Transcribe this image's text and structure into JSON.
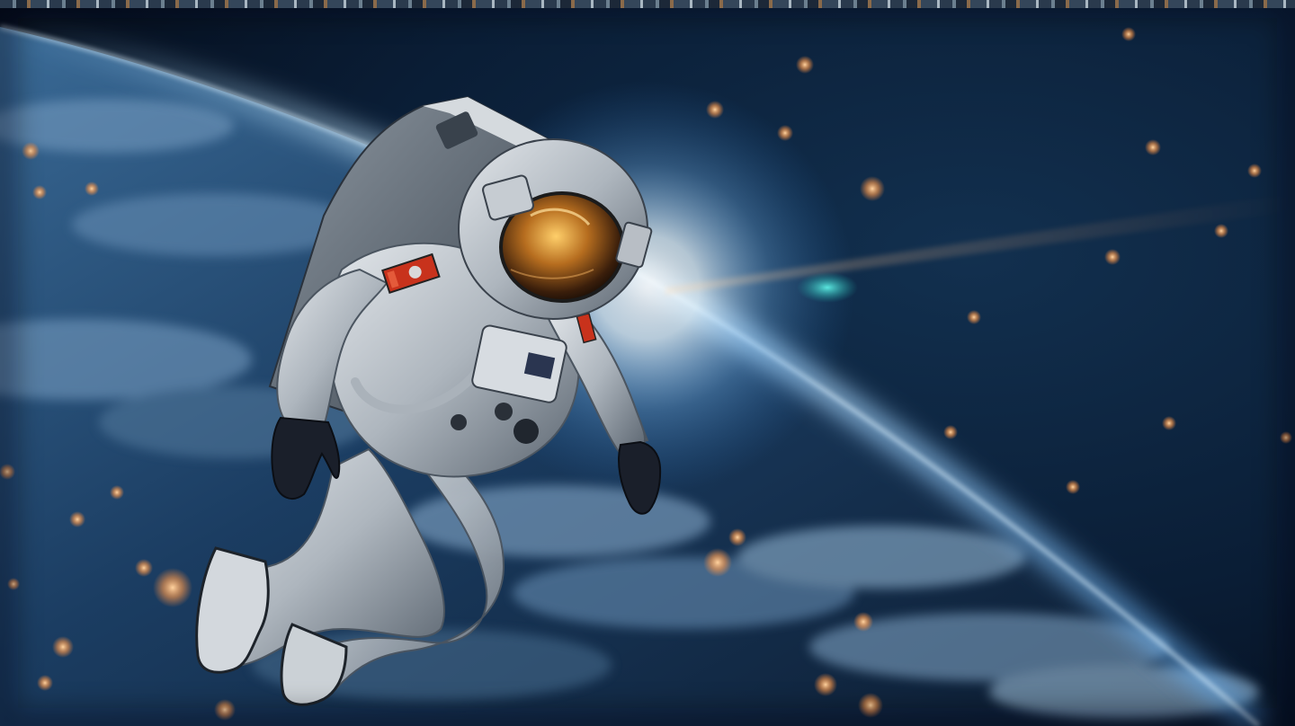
{
  "scene": {
    "subject": "astronaut-floating-above-planet",
    "palette": {
      "space_deep": "#06101f",
      "space_mid": "#0d2744",
      "atmosphere_glow": "#bfe6ff",
      "atmosphere_blue": "#2f7fd0",
      "planet_dark": "#0e2238",
      "cloud": "#5d7f9e",
      "suit": "#c9ced4",
      "suit_shadow": "#5a6470",
      "visor_gold": "#d99a35",
      "patch_red": "#c8321c",
      "bokeh_orange": "#ffb36b",
      "lens_flare_teal": "#2fc6c0"
    }
  }
}
